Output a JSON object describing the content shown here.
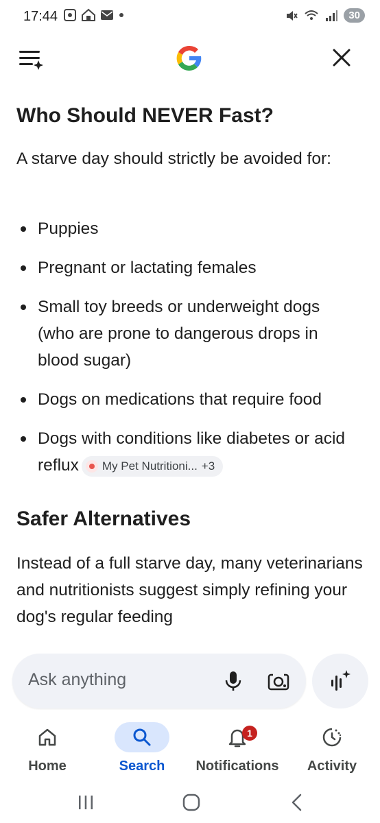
{
  "status_bar": {
    "time": "17:44",
    "battery": "30",
    "icons_left": [
      "screenshot-icon",
      "home-store-icon",
      "mail-icon",
      "dot-icon"
    ],
    "icons_right": [
      "mute-icon",
      "wifi-icon",
      "signal-icon",
      "battery-icon"
    ]
  },
  "app_bar": {
    "menu_icon": "menu-sparkle-icon",
    "logo": "google-g-logo",
    "close_icon": "close-icon"
  },
  "content": {
    "heading1": "Who Should NEVER Fast?",
    "intro": "A starve day should strictly be avoided for:",
    "bullets": [
      "Puppies",
      "Pregnant or lactating females",
      "Small toy breeds or underweight dogs (who are prone to dangerous drops in blood sugar)",
      "Dogs on medications that require food",
      "Dogs with conditions like diabetes or acid reflux"
    ],
    "source_chip": {
      "label": "My Pet Nutritioni...",
      "extra": "+3"
    },
    "heading2": "Safer Alternatives",
    "paragraph2": "Instead of a full starve day, many veterinarians and nutritionists suggest simply refining your dog's regular feeding"
  },
  "ask_bar": {
    "placeholder": "Ask anything",
    "mic_icon": "mic-icon",
    "lens_icon": "lens-icon",
    "ai_mode_icon": "ai-mode-icon"
  },
  "bottom_nav": {
    "items": [
      {
        "label": "Home",
        "icon": "home-icon",
        "active": false
      },
      {
        "label": "Search",
        "icon": "search-icon",
        "active": true
      },
      {
        "label": "Notifications",
        "icon": "bell-icon",
        "active": false,
        "badge": "1"
      },
      {
        "label": "Activity",
        "icon": "activity-icon",
        "active": false
      }
    ]
  },
  "colors": {
    "accent": "#0b57d0",
    "active_pill": "#d9e6fd",
    "badge": "#c5221f",
    "text": "#1f1f1f"
  }
}
